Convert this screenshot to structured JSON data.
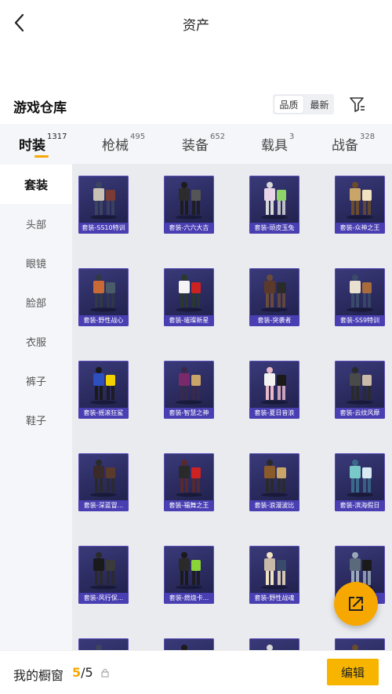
{
  "header": {
    "title": "资产"
  },
  "section": {
    "title": "游戏仓库",
    "sort": [
      "品质",
      "最新"
    ]
  },
  "tabs": [
    {
      "label": "时装",
      "count": "1317"
    },
    {
      "label": "枪械",
      "count": "495"
    },
    {
      "label": "装备",
      "count": "652"
    },
    {
      "label": "载具",
      "count": "3"
    },
    {
      "label": "战备",
      "count": "328"
    }
  ],
  "sidebar": [
    {
      "label": "套装"
    },
    {
      "label": "头部"
    },
    {
      "label": "眼镜"
    },
    {
      "label": "脸部"
    },
    {
      "label": "衣服"
    },
    {
      "label": "裤子"
    },
    {
      "label": "鞋子"
    }
  ],
  "items": [
    {
      "name": "套装-SS10特训"
    },
    {
      "name": "套装-六六大吉"
    },
    {
      "name": "套装-顽皮玉兔"
    },
    {
      "name": "套装-众神之王"
    },
    {
      "name": "套装-野性战心"
    },
    {
      "name": "套装-璀璨新星"
    },
    {
      "name": "套装-突袭者"
    },
    {
      "name": "套装-SS9特训"
    },
    {
      "name": "套装-摇滚狂鲨"
    },
    {
      "name": "套装-智慧之神"
    },
    {
      "name": "套装-夏日音浪"
    },
    {
      "name": "套装-云纹风靡"
    },
    {
      "name": "套装-深蓝冒..."
    },
    {
      "name": "套装-福舞之王"
    },
    {
      "name": "套装-浪漫波比"
    },
    {
      "name": "套装-滨海假日"
    },
    {
      "name": "套装-风行保..."
    },
    {
      "name": "套装-燃烧卡..."
    },
    {
      "name": "套装-野性战魂"
    },
    {
      "name": "套装-...训"
    }
  ],
  "bottom": {
    "label": "我的橱窗",
    "current": "5",
    "total": "/5",
    "edit": "编辑"
  },
  "colors": {
    "accent": "#f7b500",
    "card_label": "#4a3fb2",
    "card_bg": "#2a2a5e"
  }
}
